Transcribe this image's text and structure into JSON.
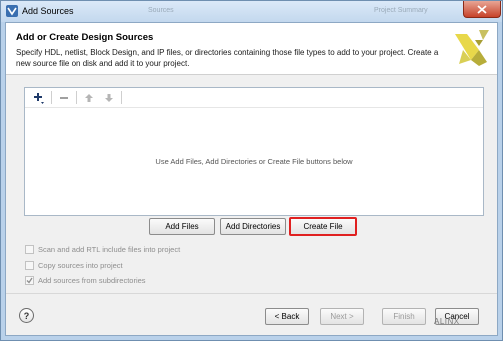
{
  "window": {
    "title": "Add Sources",
    "background_tabs": [
      "Sources",
      "Project Summary"
    ]
  },
  "header": {
    "title": "Add or Create Design Sources",
    "description": "Specify HDL, netlist, Block Design, and IP files, or directories containing those file types to add to your project. Create a new source file on disk and add it to your project."
  },
  "toolbar": {
    "icons": [
      "add-icon",
      "remove-icon",
      "move-up-icon",
      "move-down-icon"
    ]
  },
  "sources_panel": {
    "empty_hint": "Use Add Files, Add Directories or Create File buttons below"
  },
  "actions": {
    "add_files": "Add Files",
    "add_directories": "Add Directories",
    "create_file": "Create File"
  },
  "options": [
    {
      "label": "Scan and add RTL include files into project",
      "checked": false
    },
    {
      "label": "Copy sources into project",
      "checked": false
    },
    {
      "label": "Add sources from subdirectories",
      "checked": true
    }
  ],
  "footer": {
    "help": "?",
    "back": "< Back",
    "next": "Next >",
    "finish": "Finish",
    "cancel": "Cancel"
  },
  "watermark": "ALINX",
  "colors": {
    "highlight": "#e02020",
    "logo_yellow": "#e8d84a",
    "logo_dark": "#5b5b3a"
  }
}
